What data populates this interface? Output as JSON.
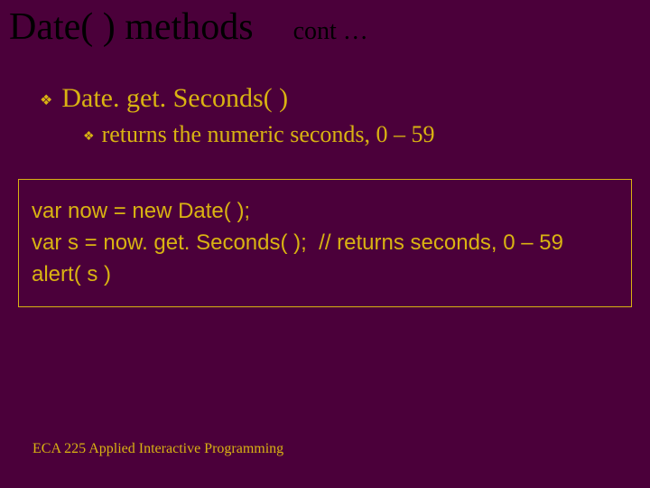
{
  "title": "Date( ) methods",
  "cont": "cont …",
  "bullets": {
    "level1": "Date. get. Seconds( )",
    "level2": "returns the numeric seconds, 0 – 59"
  },
  "code": {
    "line1": "var now = new Date( );",
    "line2": "var s = now. get. Seconds( );  // returns seconds, 0 – 59",
    "line3": "alert( s )"
  },
  "footer": "ECA 225   Applied Interactive Programming"
}
